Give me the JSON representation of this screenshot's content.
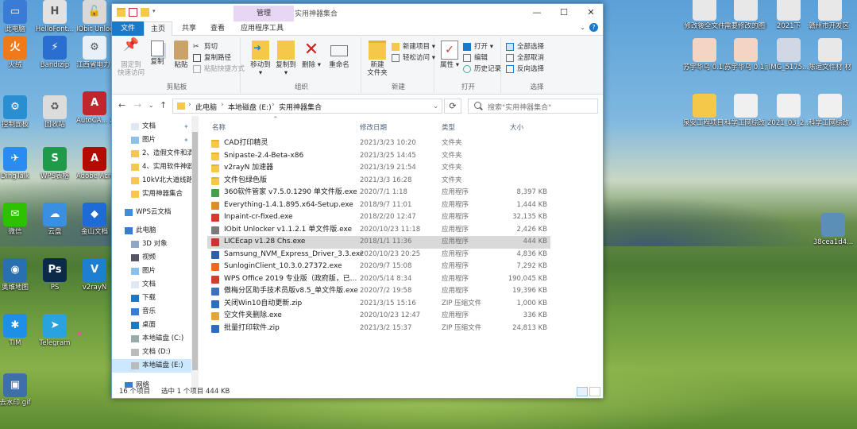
{
  "desktop": {
    "left_icons": [
      {
        "label": "此电脑",
        "color": "#3a7bd5",
        "glyph": "▭",
        "icon": "computer-icon"
      },
      {
        "label": "火绒",
        "color": "#f07a1a",
        "glyph": "火",
        "icon": "huorong-icon"
      },
      {
        "label": "控制面板",
        "color": "#2a8fd0",
        "glyph": "⚙",
        "icon": "control-panel-icon"
      },
      {
        "label": "DingTalk",
        "color": "#2a8cf0",
        "glyph": "✈",
        "icon": "dingtalk-icon"
      },
      {
        "label": "微信",
        "color": "#2dc100",
        "glyph": "✉",
        "icon": "wechat-icon"
      },
      {
        "label": "奥维地图",
        "color": "#2a6fb0",
        "glyph": "◉",
        "icon": "ovi-map-icon"
      },
      {
        "label": "TIM",
        "color": "#1e8fe6",
        "glyph": "✱",
        "icon": "tim-icon"
      },
      {
        "label": "去水印.gif",
        "color": "#3f6fa8",
        "glyph": "▣",
        "icon": "gif-file-icon"
      }
    ],
    "col2_icons": [
      {
        "label": "HelloFont...",
        "color": "#e2e2e2",
        "glyph": "H",
        "icon": "hellofont-icon"
      },
      {
        "label": "Bandizip",
        "color": "#2a6fd0",
        "glyph": "⚡",
        "icon": "bandizip-icon"
      },
      {
        "label": "回收站",
        "color": "#dcdcdc",
        "glyph": "♻",
        "icon": "recycle-bin-icon"
      },
      {
        "label": "WPS表格",
        "color": "#1f9a48",
        "glyph": "S",
        "icon": "wps-sheet-icon"
      },
      {
        "label": "云盘",
        "color": "#3a8fe0",
        "glyph": "☁",
        "icon": "cloud-drive-icon"
      },
      {
        "label": "PS",
        "color": "#0b2a4a",
        "glyph": "Ps",
        "icon": "photoshop-icon"
      },
      {
        "label": "Telegram",
        "color": "#2aa2de",
        "glyph": "➤",
        "icon": "telegram-icon"
      }
    ],
    "col3_icons": [
      {
        "label": "IObit Unlocker",
        "color": "#d9d9d9",
        "glyph": "🔓",
        "icon": "iobit-icon"
      },
      {
        "label": "江西省电力 可配网工具",
        "color": "#e8f0f8",
        "glyph": "⚙",
        "icon": "power-tool-icon"
      },
      {
        "label": "AutoCA... 2010",
        "color": "#c0272d",
        "glyph": "A",
        "icon": "autocad-icon"
      },
      {
        "label": "Adobe Acrobat D",
        "color": "#b30b00",
        "glyph": "A",
        "icon": "acrobat-icon"
      },
      {
        "label": "金山文档",
        "color": "#1f6bd6",
        "glyph": "◆",
        "icon": "kdocs-icon"
      },
      {
        "label": "v2rayN",
        "color": "#1e7fd0",
        "glyph": "V",
        "icon": "v2rayn-icon"
      }
    ],
    "right_icons": [
      {
        "label": "修改後全文件",
        "color": "#e8e8e8",
        "glyph": "",
        "icon": "doc-icon"
      },
      {
        "label": "需要修改的图 纸",
        "color": "#e8e8e8",
        "glyph": "",
        "icon": "doc-icon"
      },
      {
        "label": "2021下",
        "color": "#e8e8e8",
        "glyph": "",
        "icon": "doc-icon"
      },
      {
        "label": "赣州市开发区 10kV通用...",
        "color": "#e8e8e8",
        "glyph": "",
        "icon": "doc-icon"
      },
      {
        "label": "苏宇华乌 0.1滴2块...",
        "color": "#f4d4c4",
        "glyph": "",
        "icon": "doc-icon"
      },
      {
        "label": "苏宇华乌 0.1滴2块...",
        "color": "#f4d4c4",
        "glyph": "",
        "icon": "doc-icon"
      },
      {
        "label": "IMG_5175...",
        "color": "#cfd8e4",
        "glyph": "",
        "icon": "image-icon"
      },
      {
        "label": "陈运文件材 材料图（东...",
        "color": "#e8e8e8",
        "glyph": "",
        "icon": "doc-icon"
      },
      {
        "label": "泉安工程项目 地图.ovmap",
        "color": "#f6c84a",
        "glyph": "",
        "icon": "folder-icon"
      },
      {
        "label": "科学工网综改 项目.ovmap",
        "color": "#f0f0f0",
        "glyph": "",
        "icon": "ovmap-icon"
      },
      {
        "label": "2021_03_2... 批注（一久...",
        "color": "#f0f0f0",
        "glyph": "",
        "icon": "doc-icon"
      },
      {
        "label": "科学工网综改 项目.ovmap",
        "color": "#f0f0f0",
        "glyph": "",
        "icon": "ovmap-icon"
      },
      {
        "label": "38cea1d4...",
        "color": "#5b8fb8",
        "glyph": "",
        "icon": "image-thumb-icon"
      }
    ]
  },
  "window": {
    "context_tab": "管理",
    "title": "实用神器集合",
    "tabs": [
      "文件",
      "主页",
      "共享",
      "查看",
      "应用程序工具"
    ],
    "ribbon": {
      "clipboard": {
        "label": "剪贴板",
        "pin": "固定到\n快速访问",
        "copy": "复制",
        "paste": "粘贴",
        "cut": "剪切",
        "copy_path": "复制路径",
        "paste_shortcut": "粘贴快捷方式"
      },
      "organize": {
        "label": "组织",
        "move_to": "移动到",
        "copy_to": "复制到",
        "delete": "删除",
        "rename": "重命名"
      },
      "new": {
        "label": "新建",
        "new_folder": "新建\n文件夹",
        "new_item": "新建项目 ▾",
        "easy_access": "轻松访问 ▾"
      },
      "open": {
        "label": "打开",
        "properties": "属性",
        "open": "打开 ▾",
        "edit": "编辑",
        "history": "历史记录"
      },
      "select": {
        "label": "选择",
        "select_all": "全部选择",
        "select_none": "全部取消",
        "invert": "反向选择"
      }
    },
    "address": {
      "crumbs": [
        "此电脑",
        "本地磁盘 (E:)",
        "实用神器集合"
      ],
      "search_placeholder": "搜索\"实用神器集合\""
    },
    "nav": [
      {
        "label": "文档",
        "type": "doc",
        "pinned": true
      },
      {
        "label": "图片",
        "type": "pic",
        "pinned": true
      },
      {
        "label": "2、造假文件和清",
        "type": "folder"
      },
      {
        "label": "4、实用软件神器",
        "type": "folder"
      },
      {
        "label": "10kV北大道线路",
        "type": "folder"
      },
      {
        "label": "实用神器集合",
        "type": "folder"
      },
      {
        "label": "WPS云文档",
        "type": "cloud"
      },
      {
        "label": "此电脑",
        "type": "pc"
      },
      {
        "label": "3D 对象",
        "type": "3d"
      },
      {
        "label": "视频",
        "type": "video"
      },
      {
        "label": "图片",
        "type": "pic"
      },
      {
        "label": "文档",
        "type": "doc"
      },
      {
        "label": "下载",
        "type": "down"
      },
      {
        "label": "音乐",
        "type": "music"
      },
      {
        "label": "桌面",
        "type": "desk"
      },
      {
        "label": "本地磁盘 (C:)",
        "type": "drive"
      },
      {
        "label": "文档 (D:)",
        "type": "drive2"
      },
      {
        "label": "本地磁盘 (E:)",
        "type": "drive2",
        "selected": true
      },
      {
        "label": "网络",
        "type": "net"
      }
    ],
    "columns": {
      "name": "名称",
      "date": "修改日期",
      "type": "类型",
      "size": "大小"
    },
    "files": [
      {
        "name": "CAD打印精灵",
        "date": "2021/3/23 10:20",
        "type": "文件夹",
        "size": "",
        "icon": "folder"
      },
      {
        "name": "Snipaste-2.4-Beta-x86",
        "date": "2021/3/25 14:45",
        "type": "文件夹",
        "size": "",
        "icon": "folder"
      },
      {
        "name": "v2rayN 加速器",
        "date": "2021/3/19 21:54",
        "type": "文件夹",
        "size": "",
        "icon": "folder"
      },
      {
        "name": "文件包绿色版",
        "date": "2021/3/3 16:28",
        "type": "文件夹",
        "size": "",
        "icon": "folder"
      },
      {
        "name": "360软件管家 v7.5.0.1290 单文件版.exe",
        "date": "2020/7/1 1:18",
        "type": "应用程序",
        "size": "8,397 KB",
        "icon": "#3fa14a"
      },
      {
        "name": "Everything-1.4.1.895.x64-Setup.exe",
        "date": "2018/9/7 11:01",
        "type": "应用程序",
        "size": "1,444 KB",
        "icon": "#e28a2a"
      },
      {
        "name": "Inpaint-cr-fixed.exe",
        "date": "2018/2/20 12:47",
        "type": "应用程序",
        "size": "32,135 KB",
        "icon": "#d9392b"
      },
      {
        "name": "IObit Unlocker v1.1.2.1 单文件版.exe",
        "date": "2020/10/23 11:18",
        "type": "应用程序",
        "size": "2,426 KB",
        "icon": "#7a7a7a"
      },
      {
        "name": "LICEcap v1.28 Chs.exe",
        "date": "2018/1/1 11:36",
        "type": "应用程序",
        "size": "444 KB",
        "icon": "#c33",
        "selected": true
      },
      {
        "name": "Samsung_NVM_Express_Driver_3.3.exe",
        "date": "2020/10/23 20:25",
        "type": "应用程序",
        "size": "4,836 KB",
        "icon": "#2c5fa8"
      },
      {
        "name": "SunloginClient_10.3.0.27372.exe",
        "date": "2020/9/7 15:08",
        "type": "应用程序",
        "size": "7,292 KB",
        "icon": "#f06a1a"
      },
      {
        "name": "WPS Office 2019 专业版（政府版，已...",
        "date": "2020/5/14 8:34",
        "type": "应用程序",
        "size": "190,045 KB",
        "icon": "#d9392b"
      },
      {
        "name": "傲梅分区助手技术员版v8.5_单文件版.exe",
        "date": "2020/7/2 19:58",
        "type": "应用程序",
        "size": "19,396 KB",
        "icon": "#3b72c0"
      },
      {
        "name": "关闭Win10自动更新.zip",
        "date": "2021/3/15 15:16",
        "type": "ZIP 压缩文件",
        "size": "1,000 KB",
        "icon": "#2b6cc4"
      },
      {
        "name": "空文件夹删除.exe",
        "date": "2020/10/23 12:47",
        "type": "应用程序",
        "size": "336 KB",
        "icon": "#e9a23b"
      },
      {
        "name": "批量打印软件.zip",
        "date": "2021/3/2 15:37",
        "type": "ZIP 压缩文件",
        "size": "24,813 KB",
        "icon": "#2b6cc4"
      }
    ],
    "status": {
      "count": "16 个项目",
      "selection": "选中 1 个项目  444 KB"
    }
  },
  "colors": {
    "accent": "#1979ca",
    "selected_row": "#d9d9d9",
    "nav_selected": "#cce8ff"
  }
}
